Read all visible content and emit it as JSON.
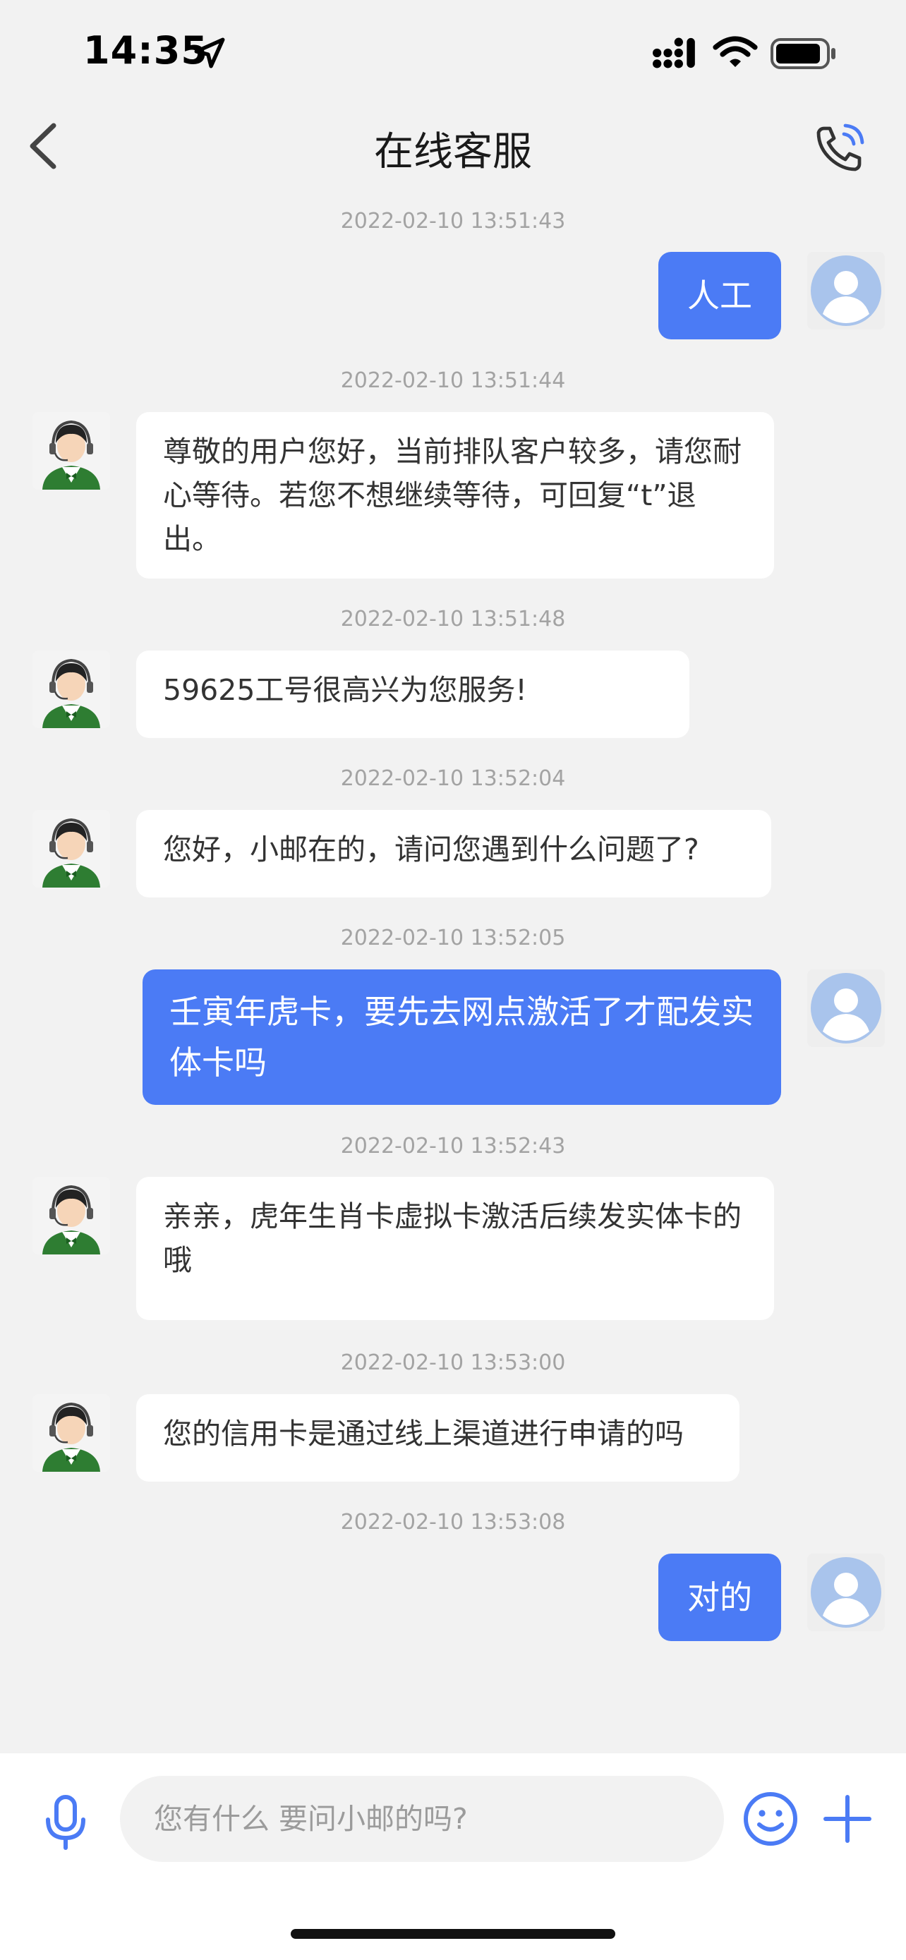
{
  "status_bar": {
    "time": "14:35"
  },
  "nav": {
    "title": "在线客服"
  },
  "messages": [
    {
      "time": "2022-02-10 13:51:43",
      "sender": "user",
      "text": "人工"
    },
    {
      "time": "2022-02-10 13:51:44",
      "sender": "agent",
      "text": "尊敬的用户您好，当前排队客户较多，请您耐心等待。若您不想继续等待，可回复“t”退出。"
    },
    {
      "time": "2022-02-10 13:51:48",
      "sender": "agent",
      "text": "59625工号很高兴为您服务!"
    },
    {
      "time": "2022-02-10 13:52:04",
      "sender": "agent",
      "text": "您好，小邮在的，请问您遇到什么问题了?"
    },
    {
      "time": "2022-02-10 13:52:05",
      "sender": "user",
      "text": "壬寅年虎卡，要先去网点激活了才配发实体卡吗"
    },
    {
      "time": "2022-02-10 13:52:43",
      "sender": "agent",
      "text": "亲亲，虎年生肖卡虚拟卡激活后续发实体卡的哦"
    },
    {
      "time": "2022-02-10 13:53:00",
      "sender": "agent",
      "text": "您的信用卡是通过线上渠道进行申请的吗"
    },
    {
      "time": "2022-02-10 13:53:08",
      "sender": "user",
      "text": "对的"
    }
  ],
  "input": {
    "placeholder": "您有什么 要问小邮的吗?"
  },
  "colors": {
    "user_bubble": "#4b7bf5",
    "background": "#f2f2f2",
    "agent_bubble": "#ffffff"
  },
  "icons": [
    "location-arrow-icon",
    "signal-icon",
    "wifi-icon",
    "battery-icon",
    "back-chevron-icon",
    "phone-call-icon",
    "agent-avatar-icon",
    "user-avatar-icon",
    "microphone-icon",
    "emoji-icon",
    "plus-icon"
  ]
}
